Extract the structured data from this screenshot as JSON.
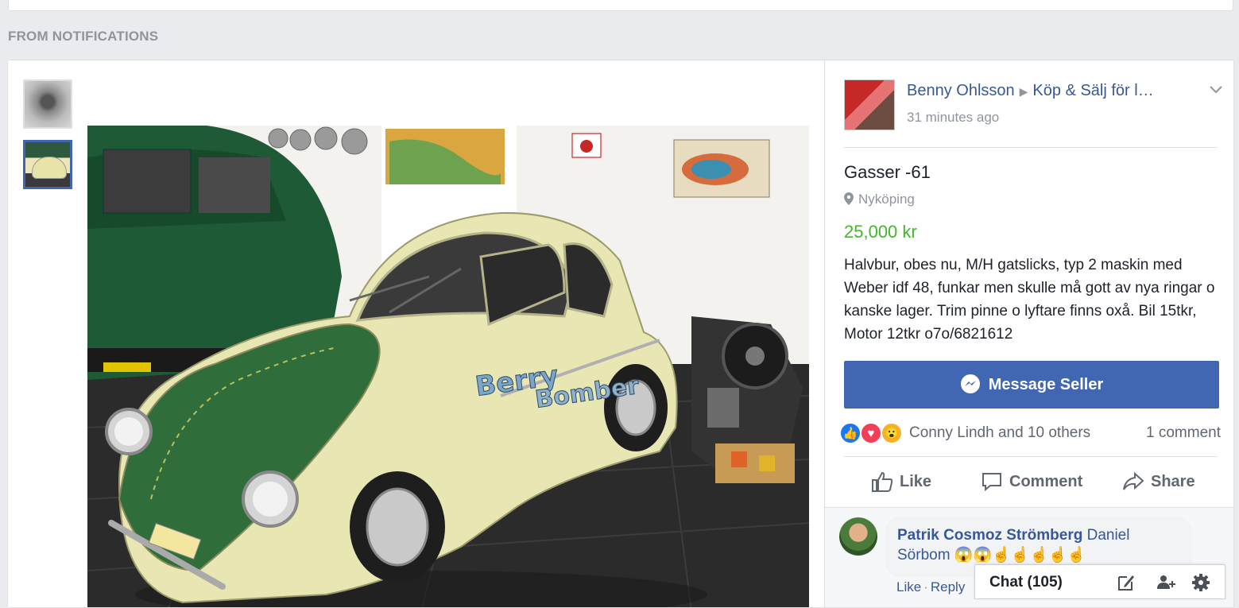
{
  "section": {
    "label": "FROM NOTIFICATIONS"
  },
  "post": {
    "author": "Benny Ohlsson",
    "group": "Köp & Sälj för l…",
    "time": "31 minutes ago",
    "title": "Gasser -61",
    "location": "Nyköping",
    "price": "25,000 kr",
    "description": "Halvbur, obes nu, M/H gatslicks, typ 2 maskin med Weber idf 48, funkar men skulle må gott av nya ringar o kanske lager. Trim pinne o lyftare finns oxå. Bil 15tkr, Motor 12tkr o7o/6821612",
    "message_label": "Message Seller",
    "reactions_text": "Conny Lindh and 10 others",
    "comment_count": "1 comment",
    "like_label": "Like",
    "comment_label": "Comment",
    "share_label": "Share",
    "car_text_1": "Berry",
    "car_text_2": "Bomber"
  },
  "comment": {
    "author": "Patrik Cosmoz Strömberg",
    "text": "Daniel Sörbom",
    "emojis": "😱😱☝☝☝☝☝",
    "like": "Like",
    "reply": "Reply"
  },
  "chat": {
    "label": "Chat (105)"
  },
  "colors": {
    "accent": "#4267b2",
    "price": "#42b72a",
    "link": "#365899",
    "muted": "#90949c"
  }
}
